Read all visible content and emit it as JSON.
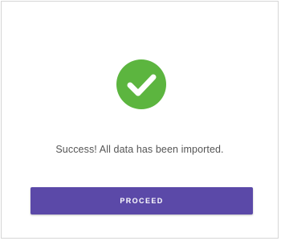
{
  "dialog": {
    "icon": "check-circle-icon",
    "icon_color": "#5cb53f",
    "message": "Success! All data has been imported.",
    "button_label": "PROCEED",
    "button_color": "#5b49a8"
  }
}
